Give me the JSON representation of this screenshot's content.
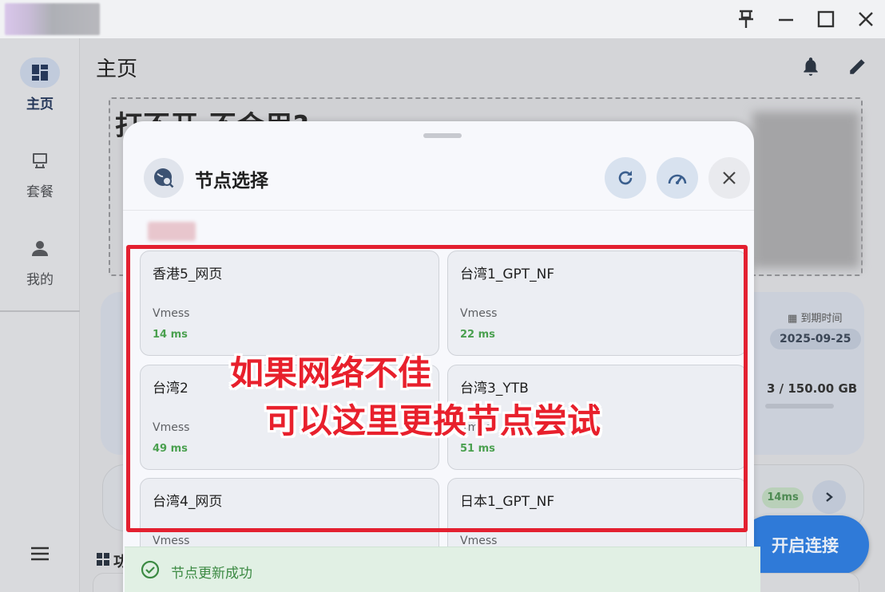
{
  "window": {
    "controls": [
      "pin-icon",
      "minimize-icon",
      "maximize-icon",
      "close-icon"
    ]
  },
  "sidebar": {
    "items": [
      {
        "label": "主页",
        "icon": "dashboard-icon",
        "active": true
      },
      {
        "label": "套餐",
        "icon": "plan-icon",
        "active": false
      },
      {
        "label": "我的",
        "icon": "person-icon",
        "active": false
      }
    ]
  },
  "main": {
    "title": "主页",
    "banner_text": "打不开 不会用?",
    "expire_label": "到期时间",
    "expire_date": "2025-09-25",
    "traffic": "3 / 150.00 GB",
    "current_node_ms": "14ms",
    "connect_label": "开启连接",
    "section_title": "功"
  },
  "sheet": {
    "title": "节点选择",
    "nodes": [
      {
        "name": "香港5_网页",
        "protocol": "Vmess",
        "latency": "14 ms"
      },
      {
        "name": "台湾1_GPT_NF",
        "protocol": "Vmess",
        "latency": "22 ms"
      },
      {
        "name": "台湾2",
        "protocol": "Vmess",
        "latency": "49 ms"
      },
      {
        "name": "台湾3_YTB",
        "protocol": "Vmess",
        "latency": "51 ms"
      },
      {
        "name": "台湾4_网页",
        "protocol": "Vmess",
        "latency": ""
      },
      {
        "name": "日本1_GPT_NF",
        "protocol": "Vmess",
        "latency": ""
      }
    ]
  },
  "annotation": {
    "line1": "如果网络不佳",
    "line2": "可以这里更换节点尝试",
    "color": "#e8202c"
  },
  "toast": {
    "text": "节点更新成功",
    "color": "#3c8a43"
  }
}
